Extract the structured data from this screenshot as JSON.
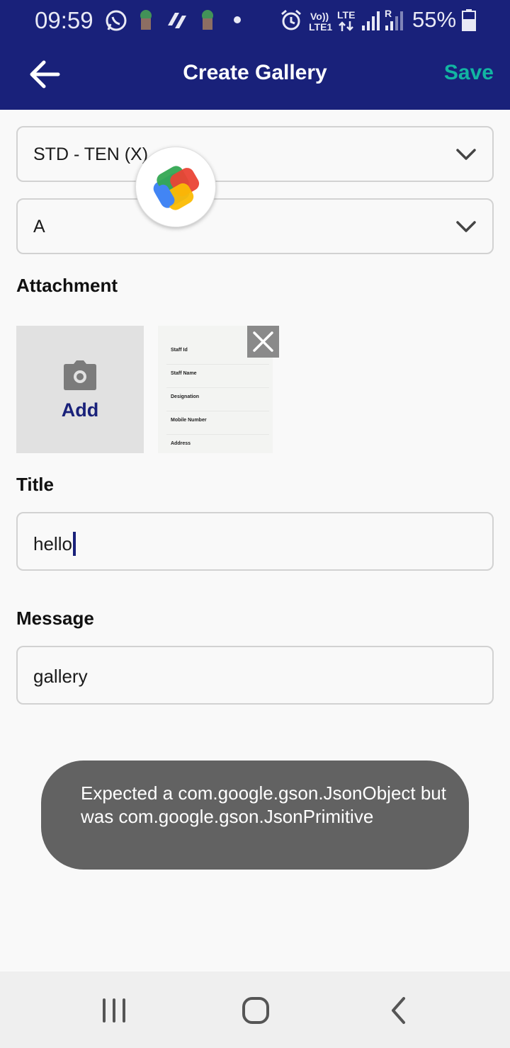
{
  "status_bar": {
    "time": "09:59",
    "battery_percent": "55%",
    "volte_label": "Vo))",
    "lte1_label": "LTE1",
    "lte_label": "LTE",
    "roaming_label": "R",
    "icons": [
      "whatsapp-icon",
      "app-icon",
      "wallet-icon",
      "app-icon",
      "dot-icon",
      "alarm-icon",
      "signal-icon",
      "signal-icon",
      "battery-icon"
    ]
  },
  "toolbar": {
    "title": "Create Gallery",
    "save_label": "Save",
    "back_icon": "arrow-left-icon"
  },
  "form": {
    "class_dropdown": {
      "value": "STD - TEN (X)"
    },
    "section_dropdown": {
      "value": "A"
    },
    "attachment_label": "Attachment",
    "add_label": "Add",
    "attachment_preview": {
      "rows": [
        "Staff Id",
        "Staff Name",
        "Designation",
        "Mobile Number",
        "Address"
      ]
    },
    "title_label": "Title",
    "title_value": "hello",
    "message_label": "Message",
    "message_value": "gallery"
  },
  "toast": {
    "message": "Expected a com.google.gson.JsonObject but was com.google.gson.JsonPrimitive"
  },
  "colors": {
    "primary": "#19217a",
    "accent": "#12b5a2",
    "toast_bg": "#626262"
  }
}
